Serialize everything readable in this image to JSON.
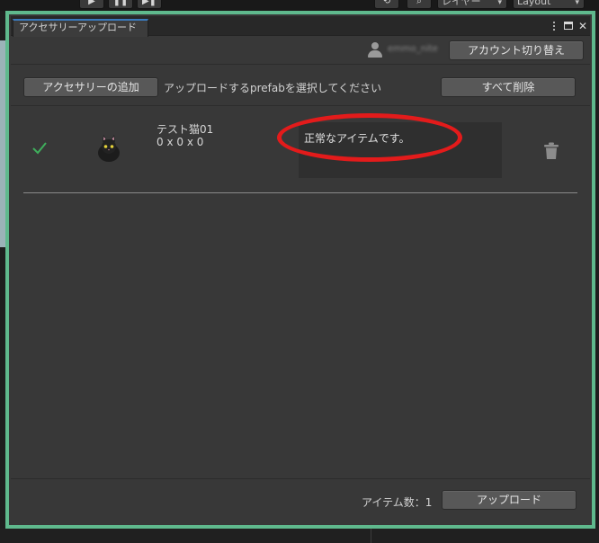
{
  "editor_toolbar": {
    "play_glyph": "▶",
    "pause_glyph": "❚❚",
    "step_glyph": "▶❚",
    "history_glyph": "⟲",
    "search_glyph": "⌕",
    "layers_label": "レイヤー",
    "layout_label": "Layout",
    "caret_glyph": "▾"
  },
  "window": {
    "tab_title": "アクセサリーアップロード",
    "close_glyph": "✕"
  },
  "account": {
    "username": "emmo_nite",
    "switch_label": "アカウント切り替え"
  },
  "select_row": {
    "add_label": "アクセサリーの追加",
    "instruction": "アップロードするprefabを選択してください",
    "delete_all_label": "すべて削除"
  },
  "items": [
    {
      "name": "テスト猫01",
      "size": "0 x 0 x 0",
      "message": "正常なアイテムです。"
    }
  ],
  "footer": {
    "count_label": "アイテム数：1",
    "upload_label": "アップロード"
  },
  "colors": {
    "highlight_frame": "#5fb98d",
    "annotation_ring": "#e31b1b",
    "check": "#3fae5c",
    "panel": "#383838"
  }
}
